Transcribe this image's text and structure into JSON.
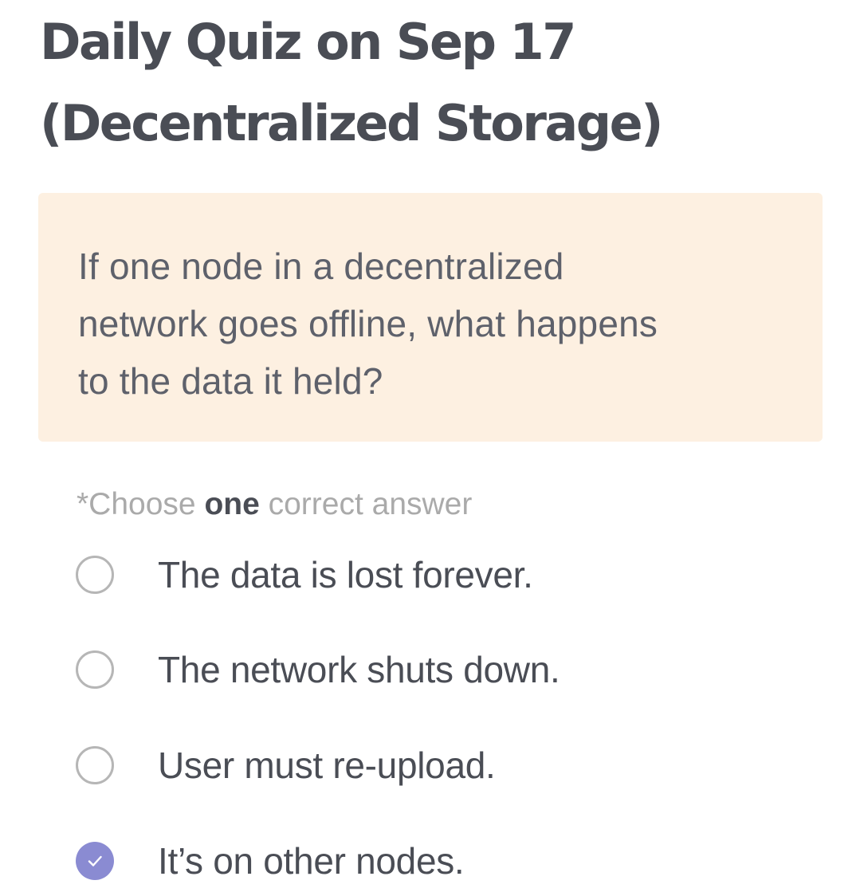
{
  "quiz": {
    "title_line1": "Daily Quiz on Sep 17",
    "title_line2": "(Decentralized Storage)",
    "question_line1": "If one node in a decentralized",
    "question_line2": "network goes offline, what happens",
    "question_line3": "to the data it held?",
    "instruction_prefix": "*Choose ",
    "instruction_emphasis": "one",
    "instruction_suffix": " correct answer",
    "options": [
      {
        "label": "The data is lost forever.",
        "selected": false
      },
      {
        "label": "The network shuts down.",
        "selected": false
      },
      {
        "label": "User must re-upload.",
        "selected": false
      },
      {
        "label": "It’s on other nodes.",
        "selected": true
      }
    ]
  },
  "colors": {
    "title": "#4a4d55",
    "question_card_background": "#fdf0e1",
    "question_text": "#5e616b",
    "instruction_muted": "#aaaaaa",
    "radio_border": "#b6b6b6",
    "radio_selected": "#8a8bd2"
  },
  "icons": {
    "unselected": "radio-unchecked-icon",
    "selected": "checkmark-icon"
  }
}
